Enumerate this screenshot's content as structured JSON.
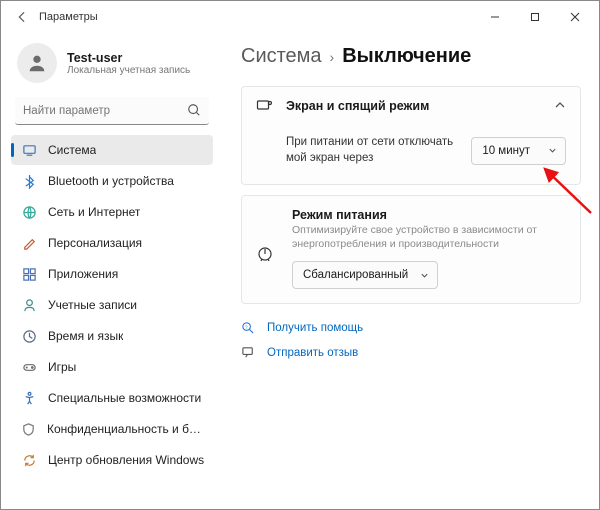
{
  "window": {
    "title": "Параметры"
  },
  "user": {
    "name": "Test-user",
    "subtitle": "Локальная учетная запись"
  },
  "search": {
    "placeholder": "Найти параметр"
  },
  "nav": [
    {
      "key": "system",
      "label": "Система"
    },
    {
      "key": "bluetooth",
      "label": "Bluetooth и устройства"
    },
    {
      "key": "network",
      "label": "Сеть и Интернет"
    },
    {
      "key": "personalization",
      "label": "Персонализация"
    },
    {
      "key": "apps",
      "label": "Приложения"
    },
    {
      "key": "accounts",
      "label": "Учетные записи"
    },
    {
      "key": "time",
      "label": "Время и язык"
    },
    {
      "key": "gaming",
      "label": "Игры"
    },
    {
      "key": "accessibility",
      "label": "Специальные возможности"
    },
    {
      "key": "privacy",
      "label": "Конфиденциальность и безопасность"
    },
    {
      "key": "update",
      "label": "Центр обновления Windows"
    }
  ],
  "breadcrumb": {
    "parent": "Система",
    "current": "Выключение"
  },
  "screenCard": {
    "title": "Экран и спящий режим",
    "row1": "При питании от сети отключать мой экран через",
    "row1value": "10 минут"
  },
  "powerCard": {
    "title": "Режим питания",
    "subtitle": "Оптимизируйте свое устройство в зависимости от энергопотребления и производительности",
    "value": "Сбалансированный"
  },
  "links": {
    "help": "Получить помощь",
    "feedback": "Отправить отзыв"
  }
}
